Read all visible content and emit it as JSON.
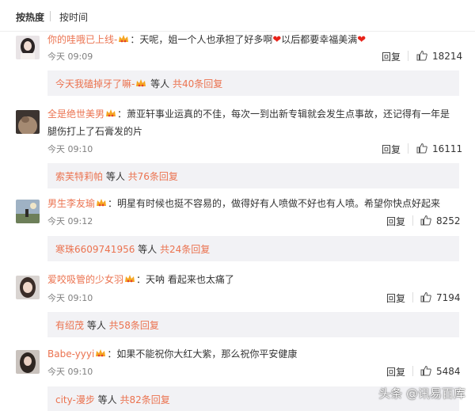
{
  "tabs": {
    "hot": "按热度",
    "time": "按时间"
  },
  "comments": [
    {
      "user": "你的哇哦已上线-",
      "text_a": "：天呢，姐一个人也承担了好多啊",
      "text_b": "以后都要幸福美满",
      "time": "今天 09:09",
      "reply": "回复",
      "likes": "18214",
      "thread_user": "今天我磕掉牙了嘛-",
      "thread_mid": " 等人 ",
      "thread_link": "共40条回复"
    },
    {
      "user": "全是绝世美男",
      "text_a": "：萧亚轩事业运真的不佳，每次一到出新专辑就会发生点事故，还记得有一年是腿伤打上了石膏发的片",
      "time": "今天 09:10",
      "reply": "回复",
      "likes": "16111",
      "thread_user": "索芙特莉帕",
      "thread_mid": " 等人 ",
      "thread_link": "共76条回复"
    },
    {
      "user": "男生李友瑜",
      "text_a": "：明星有时候也挺不容易的，做得好有人喷做不好也有人喷。希望你快点好起来",
      "time": "今天 09:12",
      "reply": "回复",
      "likes": "8252",
      "thread_user": "寒珠6609741956",
      "thread_mid": " 等人 ",
      "thread_link": "共24条回复"
    },
    {
      "user": "爱咬吸管的少女羽",
      "text_a": "：天呐 看起来也太痛了",
      "time": "今天 09:10",
      "reply": "回复",
      "likes": "7194",
      "thread_user": "有绍茂",
      "thread_mid": " 等人 ",
      "thread_link": "共58条回复"
    },
    {
      "user": "Babe-yyyi",
      "text_a": "：如果不能祝你大红大紫，那么祝你平安健康",
      "time": "今天 09:10",
      "reply": "回复",
      "likes": "5484",
      "thread_user": "city-漫步",
      "thread_mid": " 等人 ",
      "thread_link": "共82条回复"
    }
  ],
  "watermark": "头条 @讯易百库",
  "colors": {
    "link": "#eb7350",
    "reply_bg": "#f2f2f5",
    "heart": "#e8231a"
  }
}
